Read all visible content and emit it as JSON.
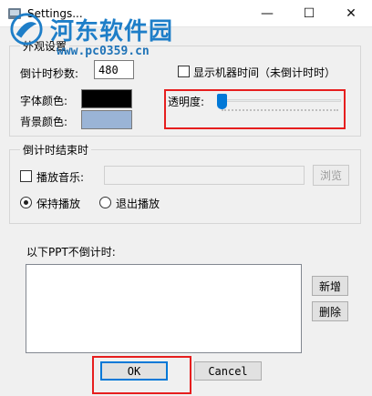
{
  "window": {
    "title": "Settings...",
    "minimize_glyph": "—",
    "maximize_glyph": "☐",
    "close_glyph": "✕"
  },
  "watermark": {
    "name": "河东软件园",
    "url": "www.pc0359.cn"
  },
  "appearance": {
    "group_label": "外观设置",
    "countdown_seconds_label": "倒计时秒数:",
    "countdown_seconds_value": "480",
    "show_clock_label": "显示机器时间（未倒计时时）",
    "show_clock_checked": false,
    "font_color_label": "字体颜色:",
    "font_color": "#000000",
    "bg_color_label": "背景颜色:",
    "bg_color": "#9ab4d6",
    "opacity_label": "透明度:",
    "opacity_value": 0.0
  },
  "end": {
    "group_label": "倒计时结束时",
    "play_music_label": "播放音乐:",
    "play_music_checked": false,
    "music_path": "",
    "browse_label": "浏览",
    "keep_playing_label": "保持播放",
    "exit_playing_label": "退出播放",
    "selected": "keep_playing"
  },
  "ppt": {
    "label": "以下PPT不倒计时:",
    "items": [],
    "add_label": "新增",
    "delete_label": "删除"
  },
  "footer": {
    "ok_label": "OK",
    "cancel_label": "Cancel"
  },
  "colors": {
    "highlight_red": "#e61e1e",
    "accent": "#0078d7"
  }
}
